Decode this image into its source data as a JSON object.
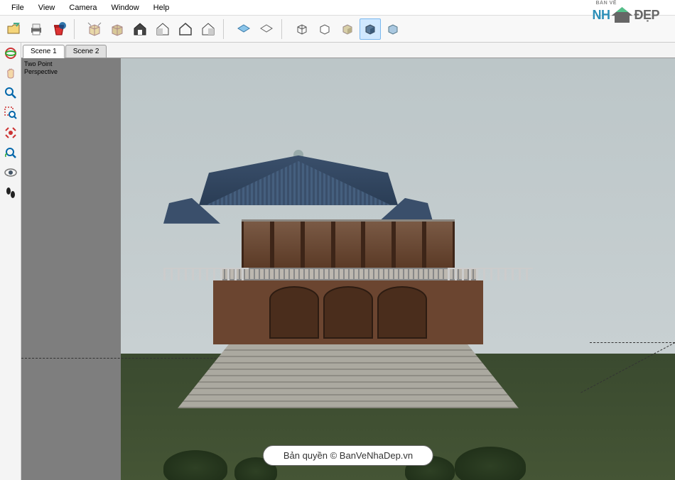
{
  "menu": {
    "file": "File",
    "view": "View",
    "camera": "Camera",
    "window": "Window",
    "help": "Help"
  },
  "tabs": {
    "scene1": "Scene 1",
    "scene2": "Scene 2"
  },
  "viewport": {
    "camera_mode_line1": "Two Point",
    "camera_mode_line2": "Perspective"
  },
  "watermark": {
    "text": "Bản quyền © BanVeNhaDep.vn"
  },
  "logo": {
    "sub": "BẢN VẼ",
    "part1": "NH",
    "part2": "ĐẸP"
  }
}
